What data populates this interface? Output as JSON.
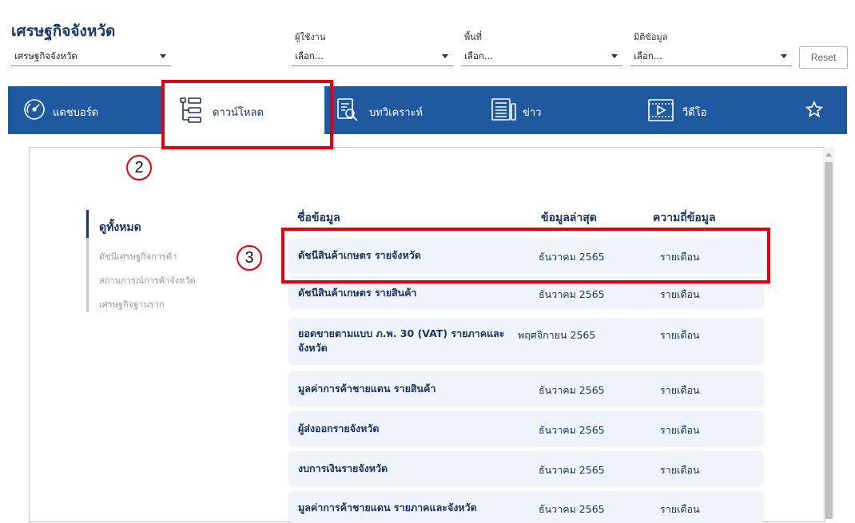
{
  "header": {
    "title": "เศรษฐกิจจังหวัด",
    "category_select": {
      "value": "เศรษฐกิจจังหวัด"
    },
    "filters": [
      {
        "label": "ผู้ใช้งาน",
        "value": "เลือก..."
      },
      {
        "label": "พื้นที่",
        "value": "เลือก..."
      },
      {
        "label": "มิติข้อมูล",
        "value": "เลือก..."
      }
    ],
    "reset_label": "Reset"
  },
  "nav": {
    "items": [
      {
        "label": "แดชบอร์ด",
        "icon": "gauge-icon"
      },
      {
        "label": "ดาวน์โหลด",
        "icon": "tree-list-icon",
        "active": true
      },
      {
        "label": "บทวิเคราะห์",
        "icon": "document-search-icon"
      },
      {
        "label": "ข่าว",
        "icon": "newspaper-icon"
      },
      {
        "label": "วีดีโอ",
        "icon": "video-icon"
      }
    ],
    "favorite_icon": "star-icon"
  },
  "sidebar": {
    "title": "ดูทั้งหมด",
    "links": [
      "ดัชนีเศรษฐกิจการค้า",
      "สถานการณ์การค้าจังหวัด",
      "เศรษฐกิจฐานราก"
    ]
  },
  "table": {
    "headers": [
      "ชื่อข้อมูล",
      "ข้อมูลล่าสุด",
      "ความถี่ข้อมูล"
    ],
    "rows": [
      {
        "name": "ดัชนีสินค้าเกษตร รายจังหวัด",
        "latest": "ธันวาคม 2565",
        "frequency": "รายเดือน"
      },
      {
        "name": "ดัชนีสินค้าเกษตร รายสินค้า",
        "latest": "ธันวาคม 2565",
        "frequency": "รายเดือน"
      },
      {
        "name": "ยอดขายตามแบบ ภ.พ. 30 (VAT) รายภาคและจังหวัด",
        "latest": "พฤศจิกายน 2565",
        "frequency": "รายเดือน"
      },
      {
        "name": "มูลค่าการค้าชายแดน รายสินค้า",
        "latest": "ธันวาคม 2565",
        "frequency": "รายเดือน"
      },
      {
        "name": "ผู้ส่งออกรายจังหวัด",
        "latest": "ธันวาคม 2565",
        "frequency": "รายเดือน"
      },
      {
        "name": "งบการเงินรายจังหวัด",
        "latest": "ธันวาคม 2565",
        "frequency": "รายเดือน"
      },
      {
        "name": "มูลค่าการค้าชายแดน รายภาคและจังหวัด",
        "latest": "ธันวาคม 2565",
        "frequency": "รายเดือน"
      }
    ]
  },
  "annotations": {
    "markers": [
      "2",
      "3"
    ],
    "highlight_color": "#e4000f"
  },
  "colors": {
    "nav_bg": "#1f5aa0",
    "text_primary": "#1b3560",
    "row_bg": "#eef4fa"
  }
}
